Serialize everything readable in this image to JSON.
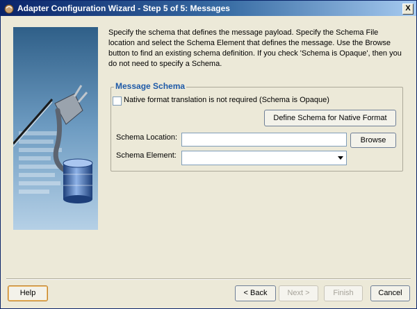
{
  "window": {
    "title": "Adapter Configuration Wizard - Step 5 of 5: Messages",
    "close_label": "X"
  },
  "intro_text": "Specify the schema that defines the message payload.  Specify the Schema File location and select the Schema Element that defines the message. Use the Browse button to find an existing schema definition. If you check 'Schema is Opaque', then you do not need to specify a Schema.",
  "message_schema": {
    "group_title": "Message Schema",
    "opaque_checkbox_label": "Native format translation is not required (Schema is Opaque)",
    "opaque_checked": false,
    "define_schema_button": "Define Schema for Native Format",
    "location_label": "Schema Location:",
    "location_value": "",
    "browse_button": "Browse",
    "element_label": "Schema Element:",
    "element_value": ""
  },
  "footer": {
    "help_button": "Help",
    "back_button": "< Back",
    "next_button": "Next >",
    "finish_button": "Finish",
    "cancel_button": "Cancel"
  },
  "colors": {
    "title_bar": "#0a246a",
    "group_title": "#1e5aa8",
    "illustration": "#3c6d96"
  }
}
